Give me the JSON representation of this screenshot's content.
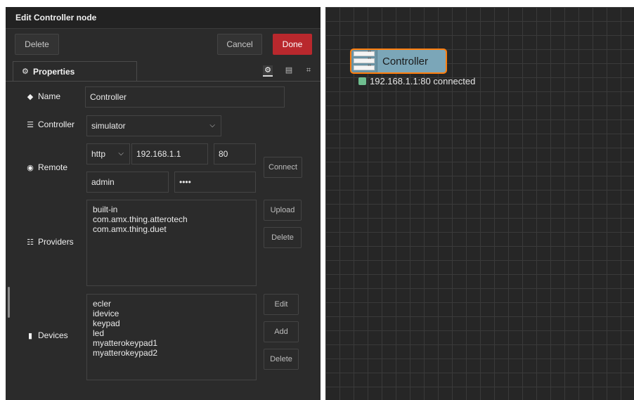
{
  "editor": {
    "title": "Edit Controller node",
    "buttons": {
      "delete": "Delete",
      "cancel": "Cancel",
      "done": "Done"
    },
    "tabs": {
      "properties": "Properties"
    },
    "fields": {
      "name": {
        "label": "Name",
        "value": "Controller"
      },
      "controller": {
        "label": "Controller",
        "value": "simulator"
      },
      "remote": {
        "label": "Remote",
        "protocol": "http",
        "host": "192.168.1.1",
        "port": "80",
        "username": "admin",
        "password": "••••",
        "connect_label": "Connect"
      },
      "providers": {
        "label": "Providers",
        "items": [
          "built-in",
          "com.amx.thing.atterotech",
          "com.amx.thing.duet"
        ],
        "upload_label": "Upload",
        "delete_label": "Delete"
      },
      "devices": {
        "label": "Devices",
        "items": [
          "ecler",
          "idevice",
          "keypad",
          "led",
          "myatterokeypad1",
          "myatterokeypad2"
        ],
        "edit_label": "Edit",
        "add_label": "Add",
        "delete_label": "Delete"
      }
    }
  },
  "canvas": {
    "node": {
      "label": "Controller",
      "fill": "#7ba6b8",
      "border": "#ff7f0e"
    },
    "status": {
      "text": "192.168.1.1:80 connected",
      "color": "#6fbe8f"
    }
  }
}
